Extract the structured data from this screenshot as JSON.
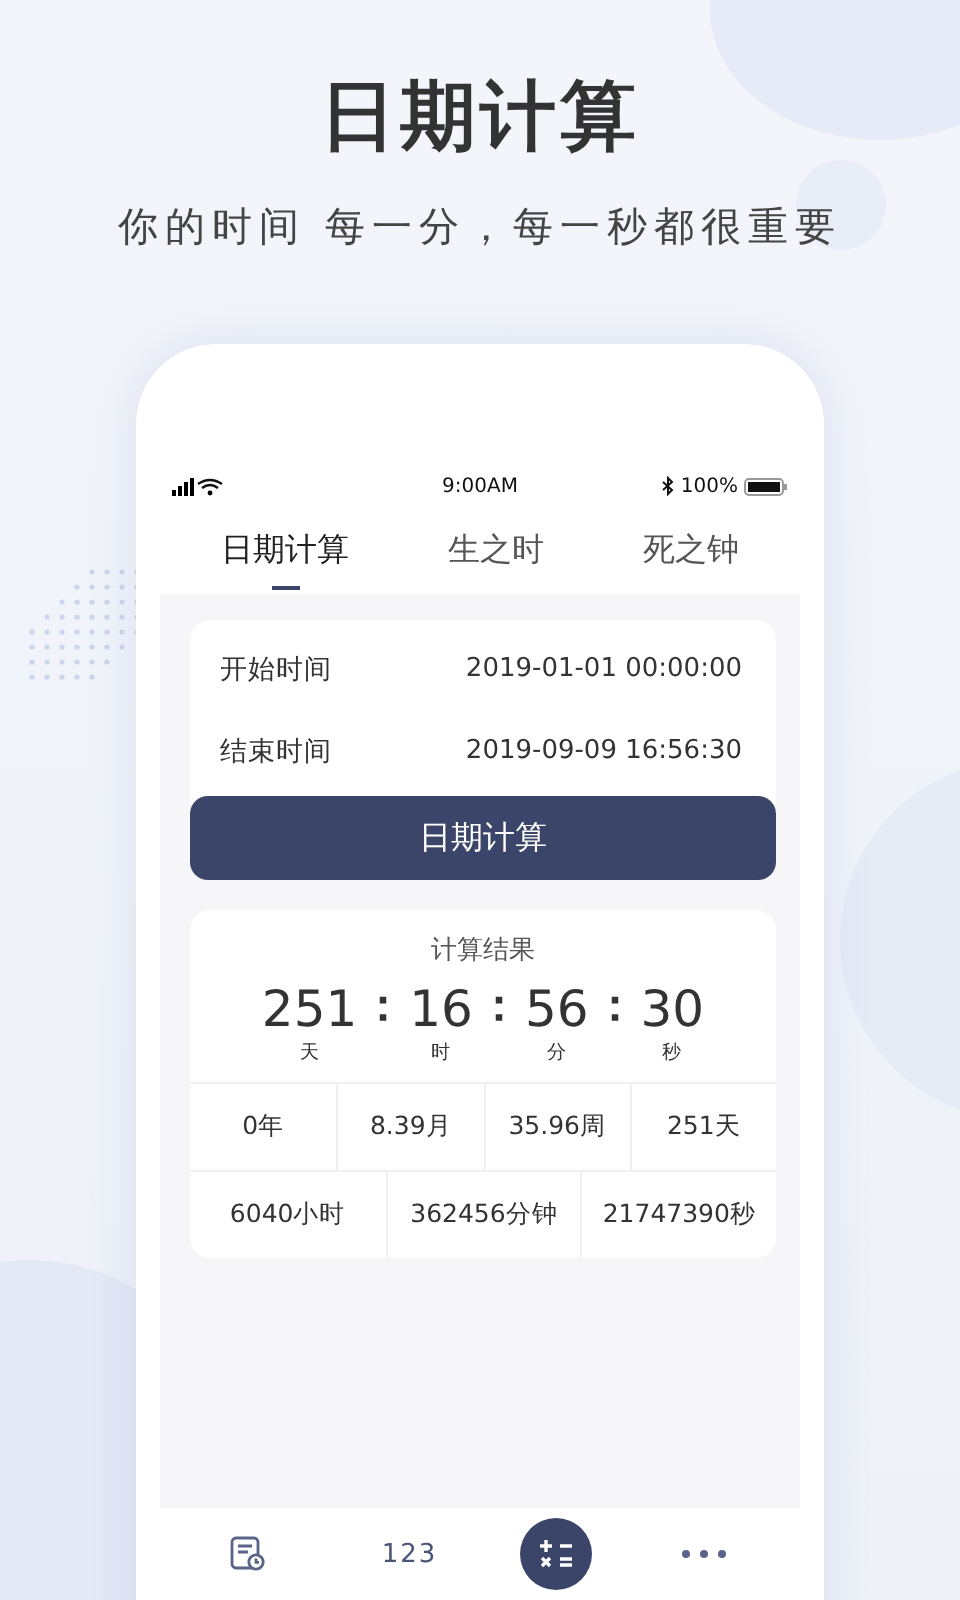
{
  "headline": {
    "title": "日期计算",
    "subtitle": "你的时间 每一分，每一秒都很重要"
  },
  "status_bar": {
    "time": "9:00AM",
    "battery": "100%"
  },
  "tabs": [
    {
      "label": "日期计算",
      "selected": true
    },
    {
      "label": "生之时",
      "selected": false
    },
    {
      "label": "死之钟",
      "selected": false
    }
  ],
  "fields": [
    {
      "label": "开始时间",
      "value": "2019-01-01 00:00:00"
    },
    {
      "label": "结束时间",
      "value": "2019-09-09 16:56:30"
    }
  ],
  "calc_button": "日期计算",
  "result": {
    "title": "计算结果",
    "separator": "：",
    "units": [
      {
        "value": "251",
        "unit": "天"
      },
      {
        "value": "16",
        "unit": "时"
      },
      {
        "value": "56",
        "unit": "分"
      },
      {
        "value": "30",
        "unit": "秒"
      }
    ],
    "row_1": [
      "0年",
      "8.39月",
      "35.96周",
      "251天"
    ],
    "row_2": [
      "6040小时",
      "362456分钟",
      "21747390秒"
    ]
  },
  "bottom_nav": [
    {
      "selected": false
    },
    {
      "label": "123",
      "selected": false
    },
    {
      "selected": true
    },
    {
      "selected": false
    }
  ]
}
